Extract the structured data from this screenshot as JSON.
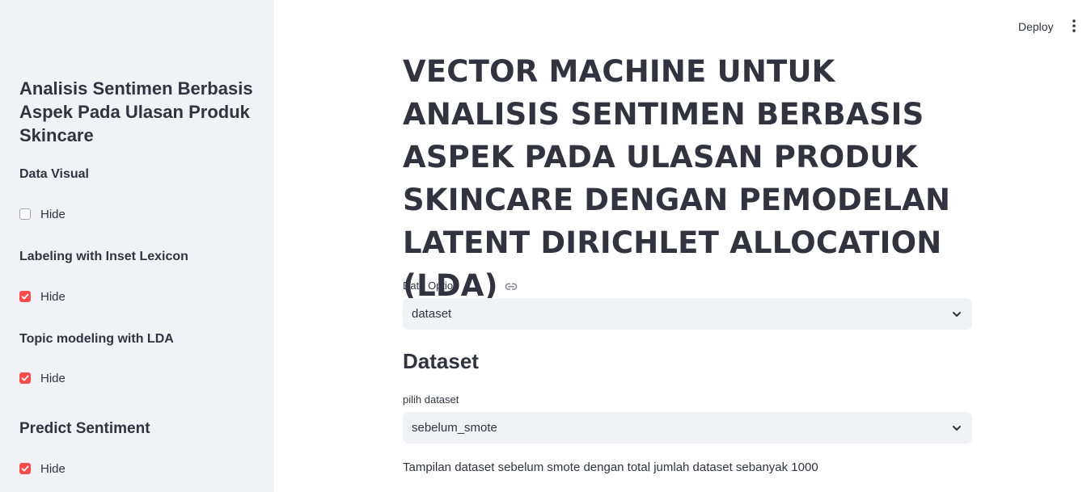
{
  "sidebar": {
    "title": "Analisis Sentimen Berbasis Aspek Pada Ulasan Produk Skincare",
    "sections": [
      {
        "heading": "Data Visual",
        "checkbox_label": "Hide",
        "checked": false
      },
      {
        "heading": "Labeling with Inset Lexicon",
        "checkbox_label": "Hide",
        "checked": true
      },
      {
        "heading": "Topic modeling with LDA",
        "checkbox_label": "Hide",
        "checked": true
      },
      {
        "heading": "Predict Sentiment",
        "checkbox_label": "Hide",
        "checked": true
      }
    ]
  },
  "toolbar": {
    "deploy_label": "Deploy",
    "menu_icon": "vertical-ellipsis-icon"
  },
  "main": {
    "title": "VECTOR MACHINE UNTUK ANALISIS SENTIMEN BERBASIS ASPEK PADA ULASAN PRODUK SKINCARE DENGAN PEMODELAN LATENT DIRICHLET ALLOCATION (LDA)",
    "title_icon": "link-icon",
    "data_option": {
      "label": "Data Option",
      "value": "dataset"
    },
    "dataset_heading": "Dataset",
    "dataset_select": {
      "label": "pilih dataset",
      "value": "sebelum_smote"
    },
    "description": "Tampilan dataset sebelum smote dengan total jumlah dataset sebanyak 1000"
  },
  "colors": {
    "sidebar_bg": "#f0f2f6",
    "accent": "#ff4b4b",
    "text": "#31333f",
    "input_bg": "#f0f2f6"
  }
}
